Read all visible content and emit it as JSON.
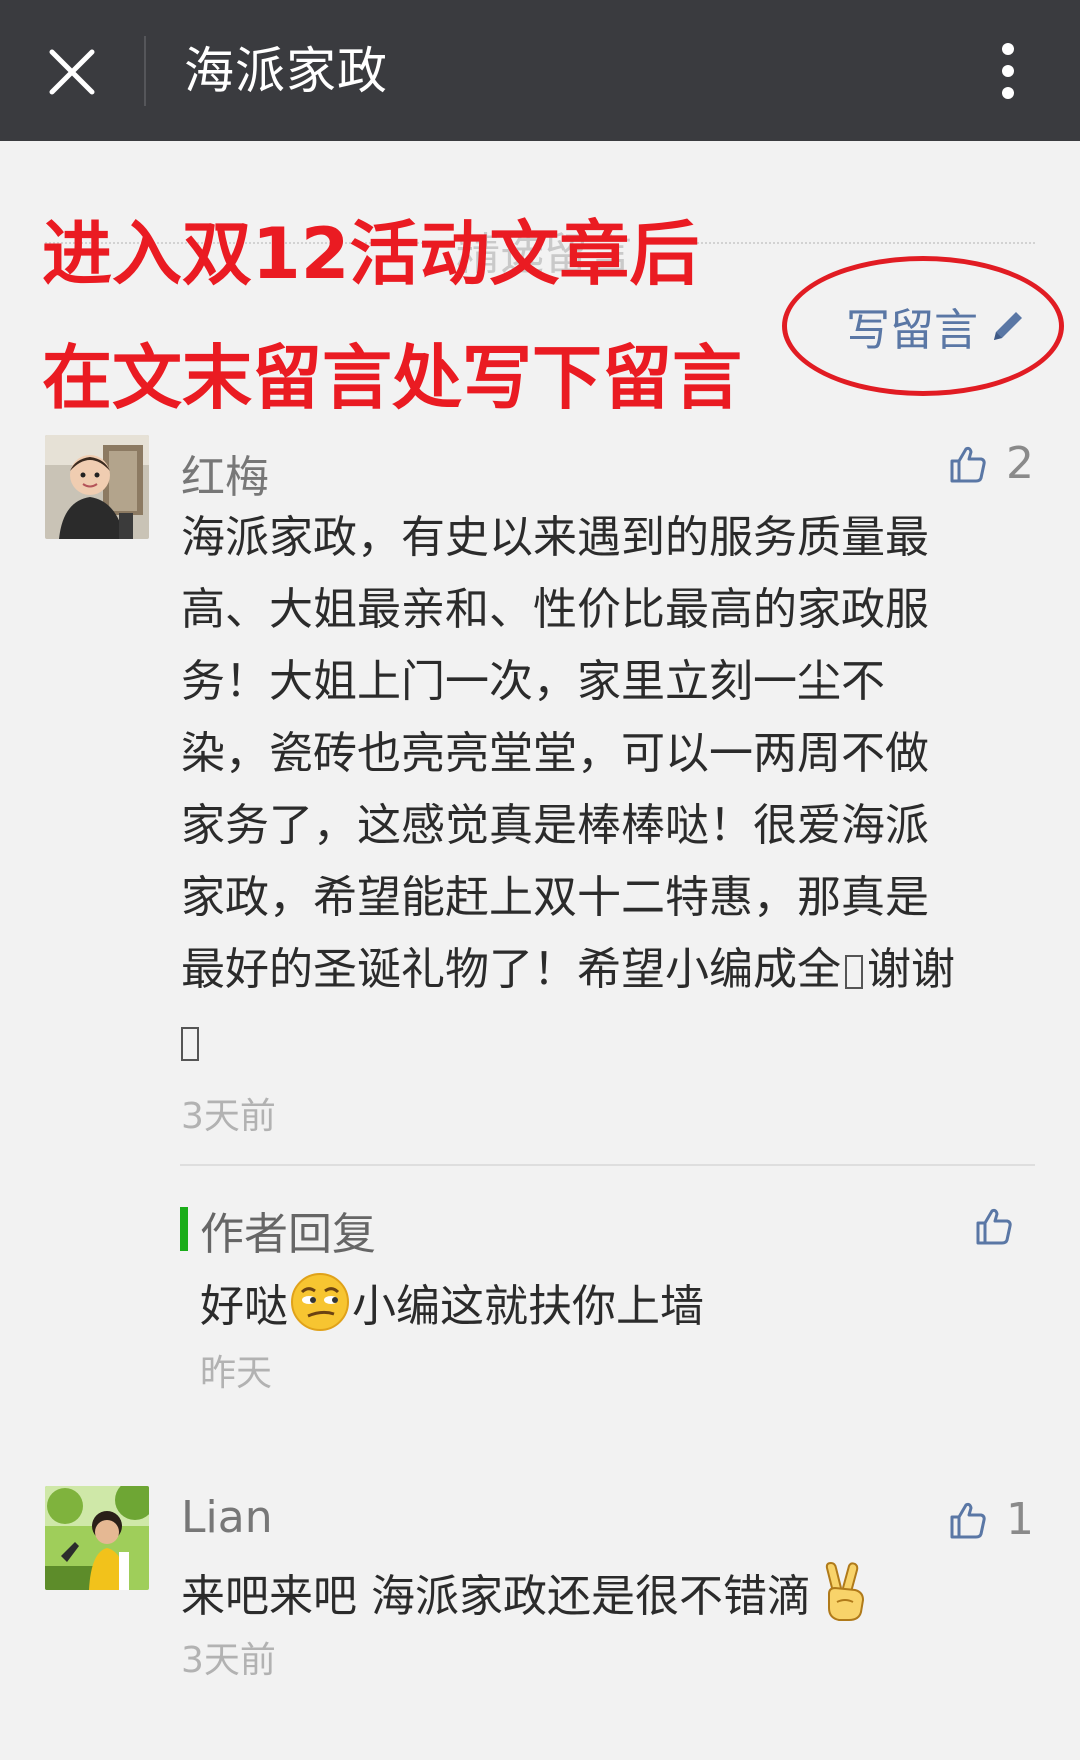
{
  "topbar": {
    "title": "海派家政"
  },
  "section": {
    "label": "精选留言"
  },
  "overlay": {
    "line1": "进入双12活动文章后",
    "line2": "在文末留言处写下留言",
    "accent_color": "#ea1b22"
  },
  "write_comment": {
    "label": "写留言"
  },
  "comments": [
    {
      "name": "红梅",
      "likes": "2",
      "lines": [
        "海派家政，有史以来遇到的服务质量最",
        "高、大姐最亲和、性价比最高的家政服",
        "务！大姐上门一次，家里立刻一尘不",
        "染，瓷砖也亮亮堂堂，可以一两周不做",
        "家务了，这感觉真是棒棒哒！很爱海派",
        "家政，希望能赶上双十二特惠，那真是",
        "最好的圣诞礼物了！希望小编成全",
        "谢谢"
      ],
      "time": "3天前",
      "reply": {
        "label": "作者回复",
        "text_before": "好哒",
        "emoji": "smirk-emoji",
        "text_after": "小编这就扶你上墙",
        "time": "昨天"
      }
    },
    {
      "name": "Lian",
      "likes": "1",
      "text": "来吧来吧 海派家政还是很不错滴",
      "emoji": "victory-hand-emoji",
      "time": "3天前"
    }
  ],
  "colors": {
    "topbar_bg": "#3a3b3f",
    "page_bg": "#f2f2f2",
    "link_blue": "#5a77a5",
    "reply_green": "#1aad19"
  }
}
